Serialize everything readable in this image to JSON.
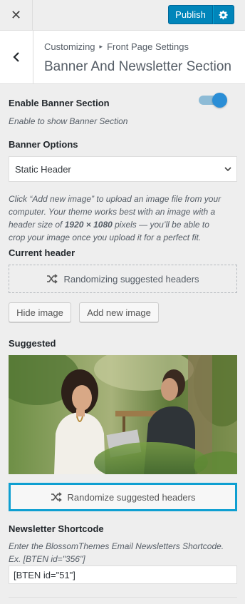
{
  "header": {
    "close_glyph": "✕",
    "publish_label": "Publish"
  },
  "section": {
    "breadcrumb_root": "Customizing",
    "breadcrumb_sep": "▸",
    "breadcrumb_parent": "Front Page Settings",
    "title": "Banner And Newsletter Section"
  },
  "banner": {
    "enable_label": "Enable Banner Section",
    "enable_desc": "Enable to show Banner Section",
    "enabled": true,
    "options_label": "Banner Options",
    "options_selected": "Static Header"
  },
  "header_image": {
    "help_line1": "Click “Add new image” to upload an image file from your",
    "help_line2": "computer. Your theme works best with an image with a",
    "help_line3_a": "header size of ",
    "help_line3_b": "1920 × 1080",
    "help_line3_c": " pixels — you’ll be able to",
    "help_line4": "crop your image once you upload it for a perfect fit.",
    "current_label": "Current header",
    "randomizing_label": "Randomizing suggested headers",
    "hide_button": "Hide image",
    "add_button": "Add new image",
    "suggested_label": "Suggested",
    "randomize_button": "Randomize suggested headers"
  },
  "newsletter": {
    "label": "Newsletter Shortcode",
    "desc_line1": "Enter the BlossomThemes Email Newsletters Shortcode.",
    "desc_line2": "Ex. [BTEN id=\"356\"]",
    "value": "[BTEN id=\"51\"]"
  },
  "colors": {
    "accent": "#0085ba",
    "focus_border": "#0e9fd1",
    "toggle_knob": "#2b8ed6"
  },
  "icons": [
    "close-icon",
    "gear-icon",
    "back-chevron-icon",
    "chevron-down-icon",
    "shuffle-icon"
  ]
}
